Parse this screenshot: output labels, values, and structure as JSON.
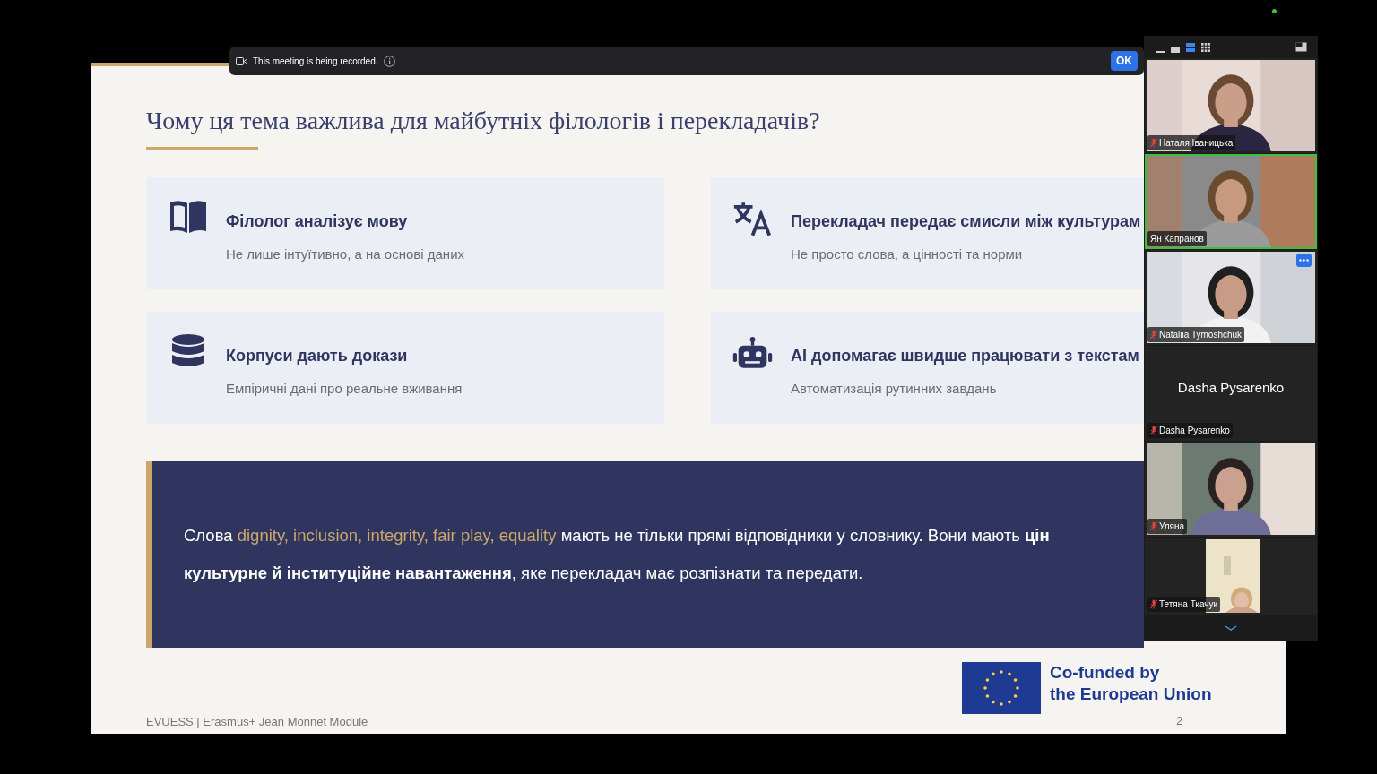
{
  "recording_banner": {
    "text": "This meeting is being recorded.",
    "button": "OK"
  },
  "slide": {
    "title": "Чому ця тема важлива для майбутніх філологів і перекладачів?",
    "cards": [
      {
        "kind": "book",
        "title": "Філолог аналізує мову",
        "subtitle": "Не лише інтуїтивно, а на основі даних"
      },
      {
        "kind": "translate",
        "title": "Перекладач передає смисли між культурам",
        "subtitle": "Не просто слова, а цінності та норми"
      },
      {
        "kind": "database",
        "title": "Корпуси дають докази",
        "subtitle": "Емпіричні дані про реальне вживання"
      },
      {
        "kind": "robot",
        "title": "AI допомагає швидше працювати з текстам",
        "subtitle": "Автоматизація рутинних завдань"
      }
    ],
    "quote_lines": [
      [
        {
          "kind": "text",
          "text": "Слова "
        },
        {
          "kind": "highlight",
          "text": "dignity, inclusion, integrity, fair play, equality"
        },
        {
          "kind": "text",
          "text": " мають не тільки прямі відповідники у словнику. Вони мають **цін**"
        }
      ],
      [
        {
          "kind": "text",
          "text": "**культурне й інституційне навантаження**, яке перекладач має розпізнати та передати."
        }
      ]
    ],
    "footer": "EVUESS | Erasmus+ Jean Monnet Module",
    "eu_label_lines": [
      "Co-funded by",
      "the European Union"
    ],
    "page_number": "2"
  },
  "view_buttons": [
    {
      "kind": "minimize",
      "selected": false
    },
    {
      "kind": "strip",
      "selected": false
    },
    {
      "kind": "speaker",
      "selected": true
    },
    {
      "kind": "grid",
      "selected": false
    }
  ],
  "participants": [
    {
      "name": "Наталя Іваницька",
      "kind": "video",
      "muted": true,
      "speaking": false,
      "options_button": false
    },
    {
      "name": "Ян Капранов",
      "kind": "video",
      "muted": false,
      "speaking": true,
      "options_button": false
    },
    {
      "name": "Nataliia Tymoshchuk",
      "kind": "video",
      "muted": true,
      "speaking": false,
      "options_button": true
    },
    {
      "name": "Dasha Pysarenko",
      "kind": "name",
      "display_name": "Dasha Pysarenko",
      "muted": true,
      "speaking": false,
      "options_button": false
    },
    {
      "name": "Уляна",
      "kind": "video",
      "muted": true,
      "speaking": false,
      "options_button": false
    },
    {
      "name": "Тетяна Ткачук",
      "kind": "narrow_video",
      "muted": true,
      "speaking": false,
      "options_button": false
    }
  ]
}
